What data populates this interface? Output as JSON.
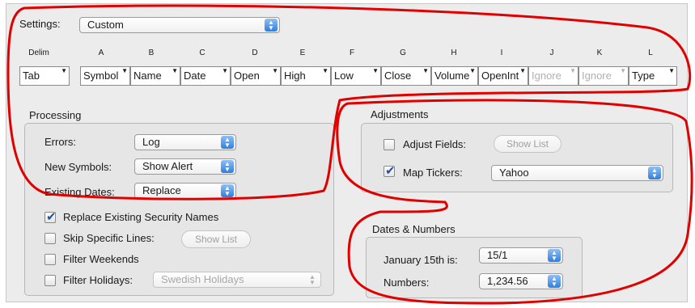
{
  "settings": {
    "label": "Settings:",
    "value": "Custom"
  },
  "columns": {
    "headers": [
      "Delim",
      "A",
      "B",
      "C",
      "D",
      "E",
      "F",
      "G",
      "H",
      "I",
      "J",
      "K",
      "L"
    ],
    "values": [
      "Tab",
      "Symbol",
      "Name",
      "Date",
      "Open",
      "High",
      "Low",
      "Close",
      "Volume",
      "OpenInt",
      "Ignore",
      "Ignore",
      "Type"
    ]
  },
  "processing": {
    "title": "Processing",
    "errors": {
      "label": "Errors:",
      "value": "Log"
    },
    "new_symbols": {
      "label": "New Symbols:",
      "value": "Show Alert"
    },
    "existing_dates": {
      "label": "Existing Dates:",
      "value": "Replace"
    },
    "replace_names": {
      "label": "Replace Existing Security Names",
      "checked": true
    },
    "skip_lines": {
      "label": "Skip Specific Lines:",
      "checked": false,
      "button": "Show List"
    },
    "filter_weekends": {
      "label": "Filter Weekends",
      "checked": false
    },
    "filter_holidays": {
      "label": "Filter Holidays:",
      "checked": false,
      "value": "Swedish Holidays"
    }
  },
  "adjustments": {
    "title": "Adjustments",
    "adjust_fields": {
      "label": "Adjust Fields:",
      "checked": false,
      "button": "Show List"
    },
    "map_tickers": {
      "label": "Map Tickers:",
      "checked": true,
      "value": "Yahoo"
    }
  },
  "dates_numbers": {
    "title": "Dates & Numbers",
    "january": {
      "label": "January 15th is:",
      "value": "15/1"
    },
    "numbers": {
      "label": "Numbers:",
      "value": "1,234.56"
    }
  },
  "colors": {
    "annotation": "#e00000",
    "accent": "#2f7ee0"
  }
}
